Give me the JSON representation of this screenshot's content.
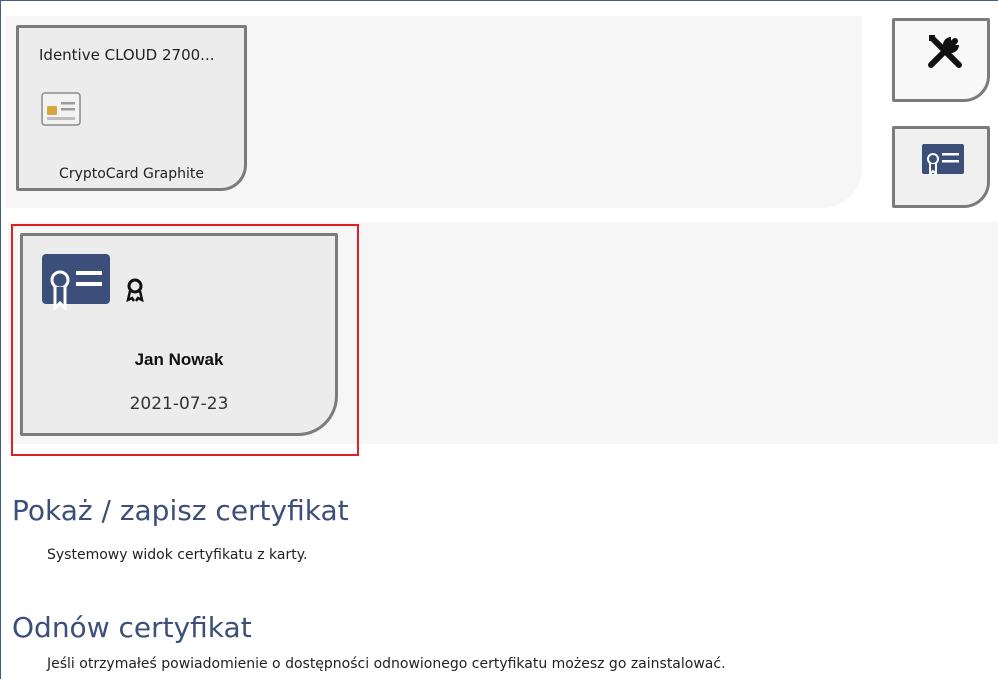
{
  "reader": {
    "name": "Identive CLOUD 2700...",
    "card_type": "CryptoCard Graphite"
  },
  "certificate": {
    "owner": "Jan Nowak",
    "date": "2021-07-23"
  },
  "actions": [
    {
      "title": "Pokaż / zapisz certyfikat",
      "description": "Systemowy widok certyfikatu z karty."
    },
    {
      "title": "Odnów certyfikat",
      "description": "Jeśli otrzymałeś powiadomienie o dostępności odnowionego certyfikatu możesz go zainstalować."
    }
  ],
  "colors": {
    "accent": "#3b4f7a",
    "highlight": "#e02020"
  },
  "icons": [
    "smart-card-icon",
    "tools-icon",
    "certificate-icon",
    "certificate-badge-icon"
  ]
}
